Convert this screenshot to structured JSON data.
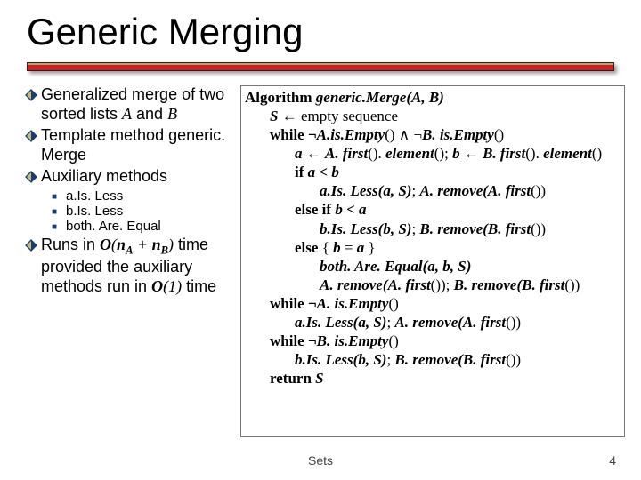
{
  "title": "Generic Merging",
  "left": {
    "b1_pre": "Generalized merge of two sorted lists ",
    "b1_A": "A",
    "b1_and": " and ",
    "b1_B": "B",
    "b2": "Template method generic. Merge",
    "b3": "Auxiliary methods",
    "s1": "a.Is. Less",
    "s2": "b.Is. Less",
    "s3": "both. Are. Equal",
    "b4_pre": "Runs in ",
    "b4_O": "O",
    "b4_paren_open": "(",
    "b4_nA_n": "n",
    "b4_nA_A": "A",
    "b4_plus": " + ",
    "b4_nB_n": "n",
    "b4_nB_B": "B",
    "b4_paren_close": ")",
    "b4_post1": " time provided the auxiliary methods run in ",
    "b4_O2": "O",
    "b4_O1val": "(1)",
    "b4_post2": " time"
  },
  "alg": {
    "l1a": "Algorithm",
    "l1b": " generic.Merge",
    "l1c": "(A, B)",
    "l2a": "S",
    "l2b": " ← empty sequence",
    "l3a": "while ¬",
    "l3b": "A.is.Empty",
    "l3c": "() ∧ ¬",
    "l3d": "B. is.Empty",
    "l3e": "()",
    "l4a": "a",
    "l4b": " ← ",
    "l4c": "A. first",
    "l4d": "(). ",
    "l4e": "element",
    "l4f": "();  ",
    "l4g": "b",
    "l4h": " ← ",
    "l4i": "B. first",
    "l4j": "(). ",
    "l4k": "element",
    "l4l": "()",
    "l5a": "if ",
    "l5b": "a",
    "l5c": " < ",
    "l5d": "b",
    "l6a": "a.Is. Less",
    "l6b": "(a, S)",
    "l6c": ";  ",
    "l6d": "A. remove",
    "l6e": "(A. first",
    "l6f": "())",
    "l7a": "else if ",
    "l7b": "b",
    "l7c": " < ",
    "l7d": "a",
    "l8a": "b.Is. Less",
    "l8b": "(b, S)",
    "l8c": ";  ",
    "l8d": "B. remove",
    "l8e": "(B. first",
    "l8f": "())",
    "l9a": "else",
    "l9b": " { ",
    "l9c": "b",
    "l9d": " = ",
    "l9e": "a",
    "l9f": " }",
    "l10a": "both. Are. Equal",
    "l10b": "(a, b, S)",
    "l11a": "A. remove",
    "l11b": "(A. first",
    "l11c": "());  ",
    "l11d": "B. remove",
    "l11e": "(B. first",
    "l11f": "())",
    "l12a": "while ¬",
    "l12b": "A. is.Empty",
    "l12c": "()",
    "l13a": "a.Is. Less",
    "l13b": "(a, S)",
    "l13c": ";  ",
    "l13d": "A. remove",
    "l13e": "(A. first",
    "l13f": "())",
    "l14a": "while ¬",
    "l14b": "B. is.Empty",
    "l14c": "()",
    "l15a": "b.Is. Less",
    "l15b": "(b, S)",
    "l15c": ";  ",
    "l15d": "B. remove",
    "l15e": "(B. first",
    "l15f": "())",
    "l16a": "return ",
    "l16b": "S"
  },
  "footer": {
    "center": "Sets",
    "page": "4"
  }
}
